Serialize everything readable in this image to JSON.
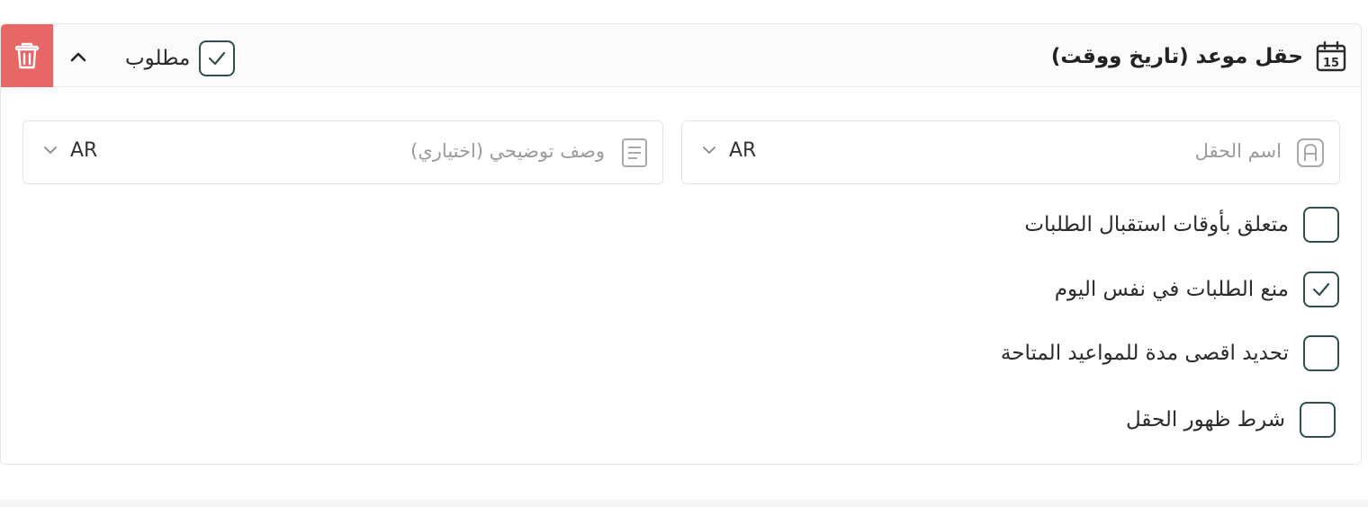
{
  "header": {
    "field_title": "حقل موعد (تاريخ ووقت)",
    "calendar_day": "15",
    "required_label": "مطلوب",
    "required_checked": true,
    "delete_color": "#e96667"
  },
  "inputs": {
    "field_name": {
      "placeholder": "اسم الحقل",
      "lang": "AR"
    },
    "description": {
      "placeholder": "وصف توضيحي (اختياري)",
      "lang": "AR"
    }
  },
  "options": [
    {
      "label": "متعلق بأوقات استقبال الطلبات",
      "checked": false
    },
    {
      "label": "منع الطلبات في نفس اليوم",
      "checked": true
    },
    {
      "label": "تحديد اقصى مدة للمواعيد المتاحة",
      "checked": false
    },
    {
      "label": "شرط ظهور الحقل",
      "checked": false
    }
  ],
  "colors": {
    "checkbox_border": "#2f4f4f",
    "accent_delete": "#e96667"
  }
}
